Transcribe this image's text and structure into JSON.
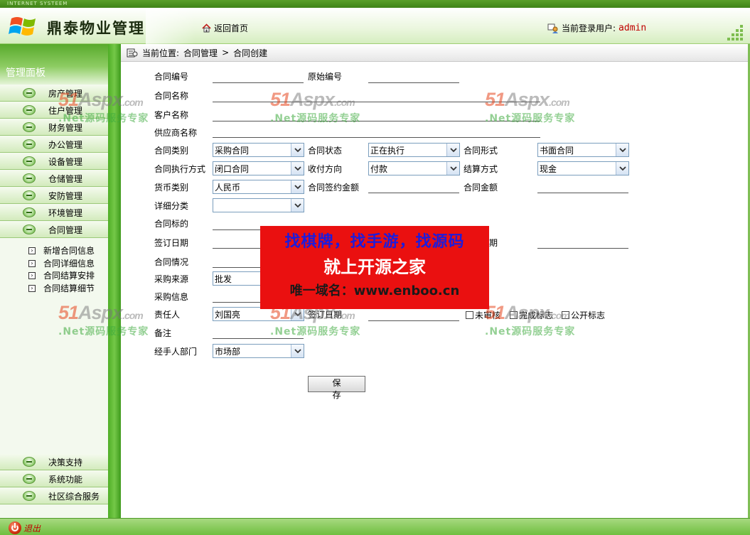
{
  "header": {
    "top_strip": "INTERNET SYSTEEM",
    "app_title": "鼎泰物业管理",
    "home_link": "返回首页",
    "user_label": "当前登录用户:",
    "user_name": "admin"
  },
  "sidebar": {
    "panel_title": "管理面板",
    "menu": [
      {
        "label": "房产管理"
      },
      {
        "label": "住户管理"
      },
      {
        "label": "财务管理"
      },
      {
        "label": "办公管理"
      },
      {
        "label": "设备管理"
      },
      {
        "label": "仓储管理"
      },
      {
        "label": "安防管理"
      },
      {
        "label": "环境管理"
      },
      {
        "label": "合同管理"
      }
    ],
    "submenu": [
      {
        "label": "新增合同信息"
      },
      {
        "label": "合同详细信息"
      },
      {
        "label": "合同结算安排"
      },
      {
        "label": "合同结算细节"
      }
    ],
    "bottom_menu": [
      {
        "label": "决策支持"
      },
      {
        "label": "系统功能"
      },
      {
        "label": "社区综合服务"
      }
    ]
  },
  "breadcrumb": {
    "prefix": "当前位置:",
    "level1": "合同管理",
    "separator": ">",
    "level2": "合同创建"
  },
  "form": {
    "contract_no": {
      "label": "合同编号",
      "value": ""
    },
    "original_no": {
      "label": "原始编号",
      "value": ""
    },
    "contract_name": {
      "label": "合同名称",
      "value": ""
    },
    "customer_name": {
      "label": "客户名称",
      "value": ""
    },
    "supplier_name": {
      "label": "供应商名称",
      "value": ""
    },
    "contract_type": {
      "label": "合同类别",
      "value": "采购合同"
    },
    "contract_status": {
      "label": "合同状态",
      "value": "正在执行"
    },
    "contract_form": {
      "label": "合同形式",
      "value": "书面合同"
    },
    "execution_mode": {
      "label": "合同执行方式",
      "value": "闭口合同"
    },
    "payment_direction": {
      "label": "收付方向",
      "value": "付款"
    },
    "settlement_method": {
      "label": "结算方式",
      "value": "现金"
    },
    "currency": {
      "label": "货币类别",
      "value": "人民币"
    },
    "signed_amount": {
      "label": "合同签约金额",
      "value": ""
    },
    "contract_amount": {
      "label": "合同金额",
      "value": ""
    },
    "detail_category": {
      "label": "详细分类",
      "value": ""
    },
    "contract_subject": {
      "label": "合同标的",
      "value": ""
    },
    "sign_date": {
      "label": "签订日期",
      "value": ""
    },
    "end_date_partial": {
      "label": "期",
      "value": ""
    },
    "contract_status_note": {
      "label": "合同情况",
      "value": ""
    },
    "purchase_source": {
      "label": "采购来源",
      "value": "批发"
    },
    "purchase_info": {
      "label": "采购信息",
      "value": ""
    },
    "responsible_person": {
      "label": "责任人",
      "value": "刘国亮"
    },
    "sign_date2": {
      "label": "签订日期",
      "value": ""
    },
    "remarks": {
      "label": "备注",
      "value": ""
    },
    "handler_dept": {
      "label": "经手人部门",
      "value": "市场部"
    },
    "checkboxes": [
      {
        "label": "未审核",
        "checked": false
      },
      {
        "label": "完成标志",
        "checked": false
      },
      {
        "label": "公开标志",
        "checked": false
      }
    ],
    "save_label": "保 存"
  },
  "watermark": {
    "logo_main": "51",
    "logo_mid": "Aspx",
    "logo_end": ".com",
    "subtitle": ".Net源码服务专家"
  },
  "ad_banner": {
    "line1": "找棋牌，找手游，找源码",
    "line2": "就上开源之家",
    "line3": "唯一域名：www.enboo.cn"
  },
  "footer": {
    "logout_label": "退出"
  },
  "colors": {
    "theme_green": "#6fbf40",
    "user_red": "#c00000",
    "banner_red": "#ea1010"
  }
}
